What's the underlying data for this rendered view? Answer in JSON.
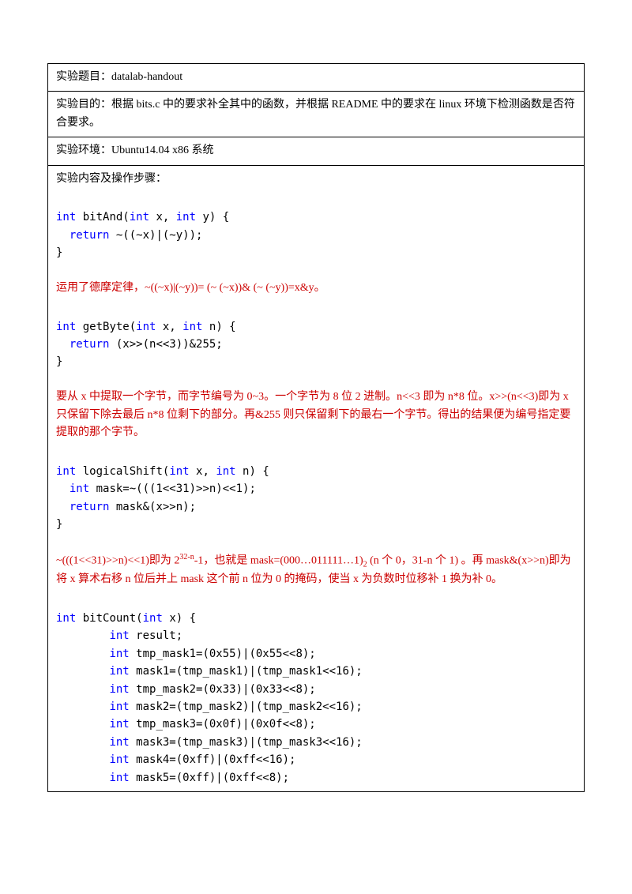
{
  "row1": {
    "label": "实验题目：",
    "text": "datalab-handout"
  },
  "row2": {
    "text": "实验目的：根据 bits.c 中的要求补全其中的函数，并根据 README 中的要求在 linux 环境下检测函数是否符合要求。"
  },
  "row3": {
    "text": "实验环境：Ubuntu14.04 x86 系统"
  },
  "content": {
    "heading": "实验内容及操作步骤：",
    "bitAnd": {
      "sig_1": "int",
      "sig_2": " bitAnd(",
      "sig_3": "int",
      "sig_4": " x, ",
      "sig_5": "int",
      "sig_6": " y) {",
      "ret_kw": "  return",
      "ret_expr": " ~((~x)|(~y));",
      "close": "}",
      "comment": "运用了德摩定律，~((~x)|(~y))= (~ (~x))& (~ (~y))=x&y。"
    },
    "getByte": {
      "sig_1": "int",
      "sig_2": " getByte(",
      "sig_3": "int",
      "sig_4": " x, ",
      "sig_5": "int",
      "sig_6": " n) {",
      "ret_kw": "  return",
      "ret_expr": " (x>>(n<<3))&255;",
      "close": "}",
      "comment": "要从 x 中提取一个字节，而字节编号为 0~3。一个字节为 8 位 2 进制。n<<3 即为 n*8 位。x>>(n<<3)即为 x 只保留下除去最后 n*8 位剩下的部分。再&255 则只保留剩下的最右一个字节。得出的结果便为编号指定要提取的那个字节。"
    },
    "logicalShift": {
      "sig_1": "int",
      "sig_2": " logicalShift(",
      "sig_3": "int",
      "sig_4": " x, ",
      "sig_5": "int",
      "sig_6": " n) {",
      "l1_kw": "  int",
      "l1_expr": " mask=~(((1<<31)>>n)<<1);",
      "ret_kw": "  return",
      "ret_expr": " mask&(x>>n);",
      "close": "}",
      "comment_p1": "~(((1<<31)>>n)<<1)即为 2",
      "comment_sup": "32-n",
      "comment_p2": "-1，也就是 mask=(000…011111…1)",
      "comment_sub": "2",
      "comment_p3": " (n 个 0，31-n 个 1) 。再 mask&(x>>n)即为将 x 算术右移 n 位后并上 mask 这个前 n 位为 0 的掩码，使当 x 为负数时位移补 1 换为补 0。"
    },
    "bitCount": {
      "sig_1": "int",
      "sig_2": " bitCount(",
      "sig_3": "int",
      "sig_4": " x) {",
      "l1_kw": "        int",
      "l1_expr": " result;",
      "l2_kw": "        int",
      "l2_expr": " tmp_mask1=(0x55)|(0x55<<8);",
      "l3_kw": "        int",
      "l3_expr": " mask1=(tmp_mask1)|(tmp_mask1<<16);",
      "l4_kw": "        int",
      "l4_expr": " tmp_mask2=(0x33)|(0x33<<8);",
      "l5_kw": "        int",
      "l5_expr": " mask2=(tmp_mask2)|(tmp_mask2<<16);",
      "l6_kw": "        int",
      "l6_expr": " tmp_mask3=(0x0f)|(0x0f<<8);",
      "l7_kw": "        int",
      "l7_expr": " mask3=(tmp_mask3)|(tmp_mask3<<16);",
      "l8_kw": "        int",
      "l8_expr": " mask4=(0xff)|(0xff<<16);",
      "l9_kw": "        int",
      "l9_expr": " mask5=(0xff)|(0xff<<8);"
    }
  }
}
